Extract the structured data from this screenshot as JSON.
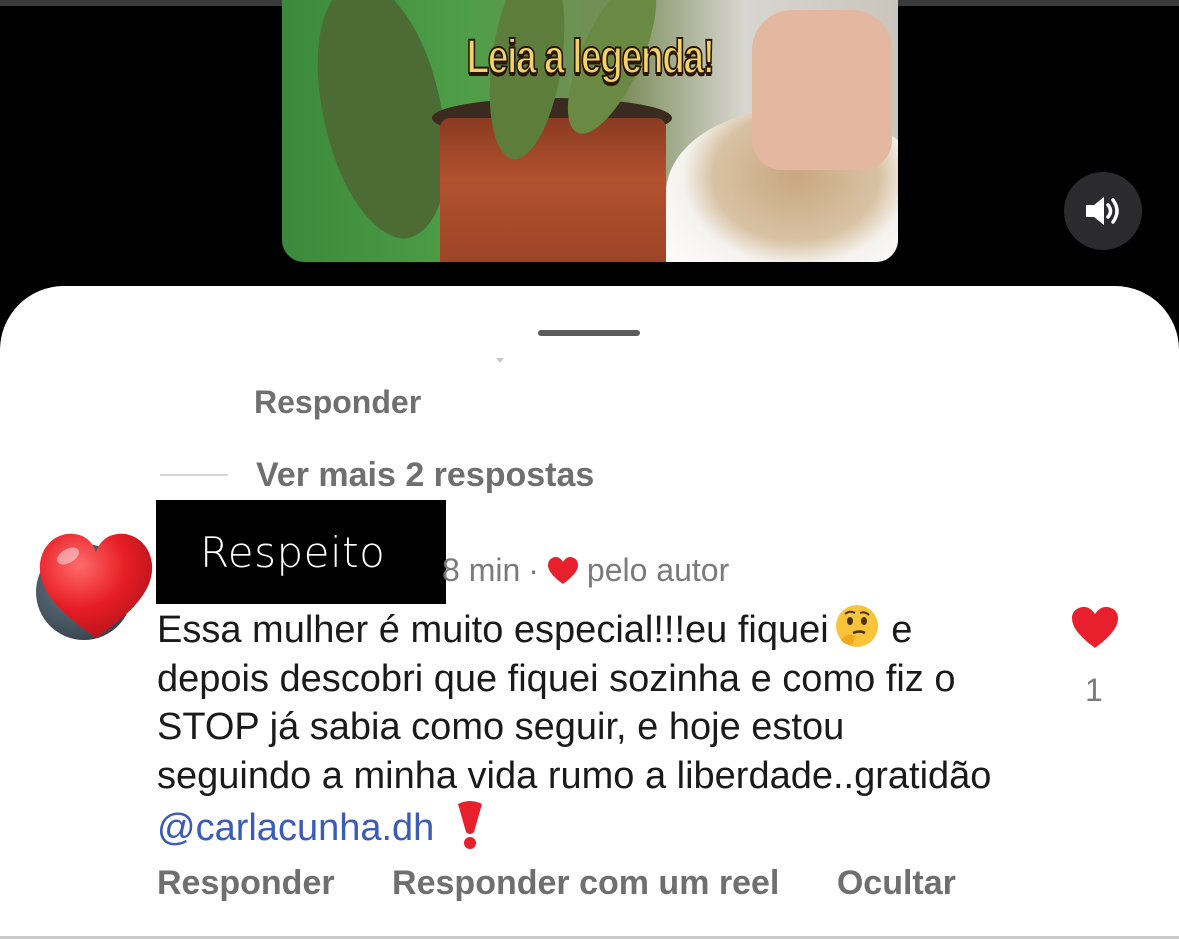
{
  "video": {
    "caption": "Leia a legenda!"
  },
  "icons": {
    "sound": "speaker-on-icon",
    "heart": "heart-icon",
    "reaction": "heart-emoji-icon",
    "thinking": "thinking-face-icon",
    "exclamation": "red-exclamation-icon"
  },
  "colors": {
    "heart_red": "#e8202e",
    "mention_blue": "#3b5bb7",
    "muted_text": "#6f6f6f"
  },
  "comments": {
    "previous_reply_label": "Responder",
    "view_more_replies": "Ver mais 2 respostas",
    "highlighted": {
      "username_overlay": "Respeito",
      "time": "8 min",
      "separator": "·",
      "liked_by_author": "pelo autor",
      "text_before_emoji": "Essa mulher é muito especial!!!eu fiquei",
      "text_after_emoji": "e depois descobri que fiquei sozinha e como fiz o STOP já sabia como seguir, e hoje estou seguindo a minha vida rumo a liberdade..gratidão",
      "mention": "@carlacunha.dh",
      "like_count": "1",
      "actions": {
        "reply": "Responder",
        "reply_reel": "Responder com um reel",
        "hide": "Ocultar"
      }
    }
  }
}
